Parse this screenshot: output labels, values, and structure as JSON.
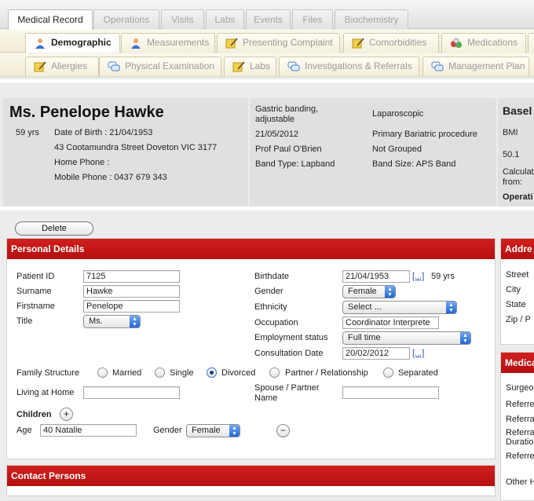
{
  "top_tabs": [
    "Medical Record",
    "Operations",
    "Visits",
    "Labs",
    "Events",
    "Files",
    "Biochemistry"
  ],
  "sub_tabs_row1": [
    "Demographic",
    "Measurements",
    "Presenting Complaint",
    "Comorbidities",
    "Medications"
  ],
  "sub_tabs_row2": [
    "Allergies",
    "Physical Examination",
    "Labs",
    "Investigations & Referrals",
    "Management Plan"
  ],
  "patient": {
    "name": "Ms. Penelope Hawke",
    "age": "59 yrs",
    "dob": "Date of Birth : 21/04/1953",
    "address": "43 Cootamundra Street Doveton VIC 3177",
    "home_phone": "Home Phone :",
    "mobile_phone": "Mobile Phone : 0437 679 343"
  },
  "operation": {
    "procedure": "Gastric banding, adjustable",
    "date": "21/05/2012",
    "surgeon": "Prof Paul O'Brien",
    "band_type": "Band Type: Lapband",
    "approach": "Laparoscopic",
    "category": "Primary Bariatric procedure",
    "group": "Not Grouped",
    "band_size": "Band Size: APS Band"
  },
  "baseline": {
    "title": "Basel",
    "bmi_label": "BMI",
    "bmi_value": "50.1",
    "calc_label_1": "Calculat",
    "calc_label_2": "from:",
    "operation_label": "Operati"
  },
  "delete_label": "Delete",
  "personal": {
    "title": "Personal Details",
    "patient_id_label": "Patient ID",
    "patient_id": "7125",
    "surname_label": "Surname",
    "surname": "Hawke",
    "firstname_label": "Firstname",
    "firstname": "Penelope",
    "title_label": "Title",
    "title_value": "Ms.",
    "birthdate_label": "Birthdate",
    "birthdate": "21/04/1953",
    "birthdate_link": "[...]",
    "age": "59 yrs",
    "gender_label": "Gender",
    "gender": "Female",
    "ethnicity_label": "Ethnicity",
    "ethnicity": "Select ...",
    "occupation_label": "Occupation",
    "occupation": "Coordinator Interprete",
    "employment_label": "Employment status",
    "employment": "Full time",
    "consultation_label": "Consultation Date",
    "consultation": "20/02/2012",
    "consultation_link": "[...]",
    "family_label": "Family Structure",
    "family_options": [
      "Married",
      "Single",
      "Divorced",
      "Partner / Relationship",
      "Separated"
    ],
    "family_selected": "Divorced",
    "living_label": "Living at Home",
    "living_value": "",
    "spouse_label_1": "Spouse / Partner",
    "spouse_label_2": "Name",
    "spouse_value": "",
    "children_label": "Children",
    "add_child": "+",
    "age_label": "Age",
    "child_age": "40 Natalie",
    "child_gender_label": "Gender",
    "child_gender": "Female",
    "remove_child": "−"
  },
  "address": {
    "title": "Addre",
    "street": "Street",
    "city": "City",
    "state": "State",
    "zip": "Zip / P"
  },
  "medical": {
    "title": "Medica",
    "surgeon": "Surgeo",
    "referrer1": "Referre",
    "referral1": "Referra",
    "referral2": "Referra",
    "duration": "Duratio",
    "referrer2": "Referre",
    "other": "Other H"
  },
  "contact": {
    "title": "Contact Persons"
  },
  "colors": {
    "panel_header": "#c41818",
    "subtab_bg": "#f4f0dc",
    "header_grey": "#e0e0e0"
  },
  "icons": {
    "demographic": "person-icon",
    "measurements": "person-icon",
    "presenting": "notepad-pencil-icon",
    "comorbidities": "notepad-pencil-icon",
    "medications": "pills-icon",
    "allergies": "notepad-pencil-icon",
    "physical": "speech-bubbles-icon",
    "labs": "notepad-pencil-icon",
    "investigations": "speech-bubbles-icon",
    "management": "speech-bubbles-icon"
  }
}
